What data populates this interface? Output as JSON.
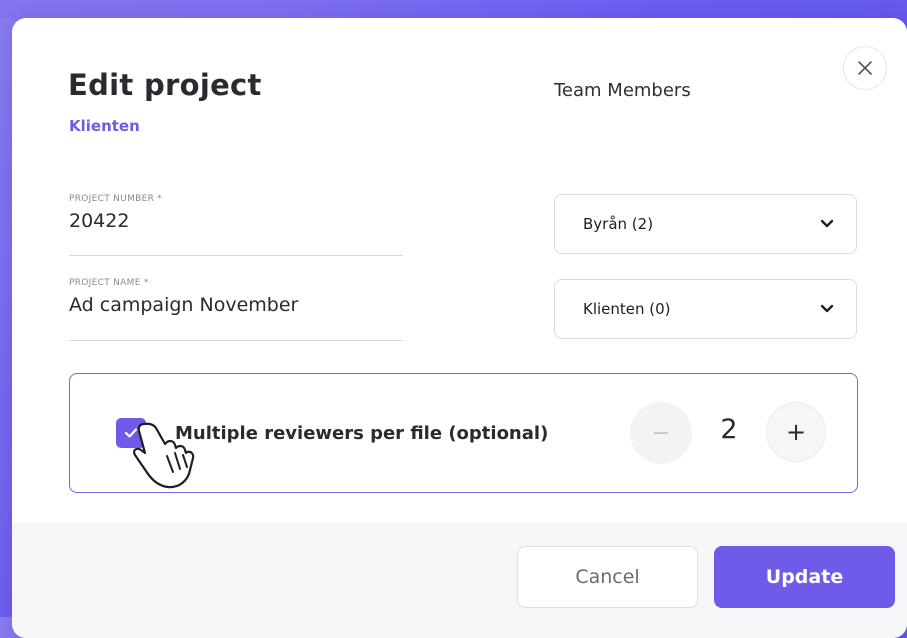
{
  "modal": {
    "title": "Edit project",
    "client_link": "Klienten",
    "team_heading": "Team Members",
    "close_icon": "close-icon"
  },
  "fields": {
    "project_number": {
      "label": "PROJECT NUMBER *",
      "value": "20422"
    },
    "project_name": {
      "label": "PROJECT NAME *",
      "value": "Ad campaign November"
    }
  },
  "team_selects": [
    {
      "label": "Byrån (2)",
      "icon": "chevron-down-icon"
    },
    {
      "label": "Klienten (0)",
      "icon": "chevron-down-icon"
    }
  ],
  "reviewers": {
    "checked": true,
    "label": "Multiple reviewers per file (optional)",
    "minus_symbol": "−",
    "plus_symbol": "+",
    "count": "2"
  },
  "footer": {
    "cancel_label": "Cancel",
    "update_label": "Update"
  },
  "colors": {
    "accent": "#6e5ce8",
    "background": "#6a5cf0",
    "text": "#2a2a30"
  }
}
